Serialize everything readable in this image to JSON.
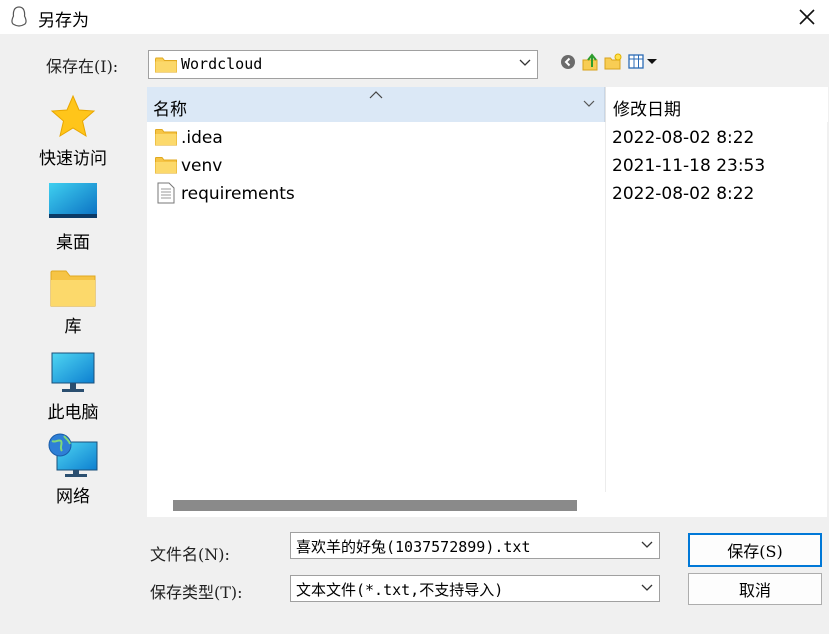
{
  "window": {
    "title": "另存为"
  },
  "look_in": {
    "label": "保存在(I):",
    "value": "Wordcloud"
  },
  "toolbar": {
    "icons": [
      "back-icon",
      "up-folder-icon",
      "new-folder-icon",
      "view-menu-icon"
    ]
  },
  "places": [
    {
      "label": "快速访问",
      "icon": "star-icon"
    },
    {
      "label": "桌面",
      "icon": "desktop-icon"
    },
    {
      "label": "库",
      "icon": "library-folder-icon"
    },
    {
      "label": "此电脑",
      "icon": "computer-icon"
    },
    {
      "label": "网络",
      "icon": "network-icon"
    }
  ],
  "columns": {
    "name": "名称",
    "modified": "修改日期"
  },
  "files": [
    {
      "name": ".idea",
      "modified": "2022-08-02 8:22",
      "type": "folder"
    },
    {
      "name": "venv",
      "modified": "2021-11-18 23:53",
      "type": "folder"
    },
    {
      "name": "requirements",
      "modified": "2022-08-02 8:22",
      "type": "file"
    }
  ],
  "filename": {
    "label": "文件名(N):",
    "value": "喜欢羊的好兔(1037572899).txt"
  },
  "filetype": {
    "label": "保存类型(T):",
    "value": "文本文件(*.txt,不支持导入)"
  },
  "buttons": {
    "save": "保存(S)",
    "cancel": "取消"
  },
  "colors": {
    "header_bg": "#dbe8f6",
    "accent": "#0078d7",
    "folder": "#f7c948"
  }
}
